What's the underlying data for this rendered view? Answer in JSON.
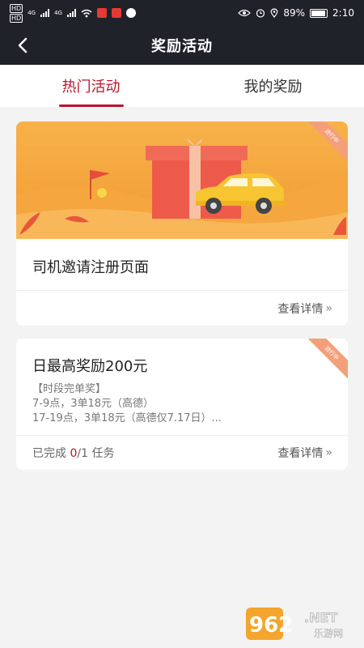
{
  "status_bar": {
    "hd_labels": [
      "HD",
      "HD"
    ],
    "network_1": "4G",
    "network_2": "4G",
    "battery": "89%",
    "time": "2:10"
  },
  "nav": {
    "title": "奖励活动"
  },
  "tabs": [
    {
      "label": "热门活动",
      "active": true
    },
    {
      "label": "我的奖励",
      "active": false
    }
  ],
  "cards": [
    {
      "title": "司机邀请注册页面",
      "detail_label": "查看详情",
      "chevron": "»",
      "tag": "进行中"
    },
    {
      "title": "日最高奖励200元",
      "lines": [
        "【时段完单奖】",
        "7-9点，3单18元（高德）",
        "17-19点，3单18元（高德仅7.17日）..."
      ],
      "progress": {
        "prefix": "已完成 ",
        "done": "0",
        "total": "/1 任务"
      },
      "detail_label": "查看详情",
      "chevron": "»",
      "tag": "进行中"
    }
  ],
  "watermark": {
    "number": "962",
    "net": ".NET",
    "sub": "乐游网"
  },
  "colors": {
    "accent": "#b8162d",
    "header": "#1f2229",
    "banner_orange": "#f5a53a",
    "tag": "#f3a07a"
  }
}
